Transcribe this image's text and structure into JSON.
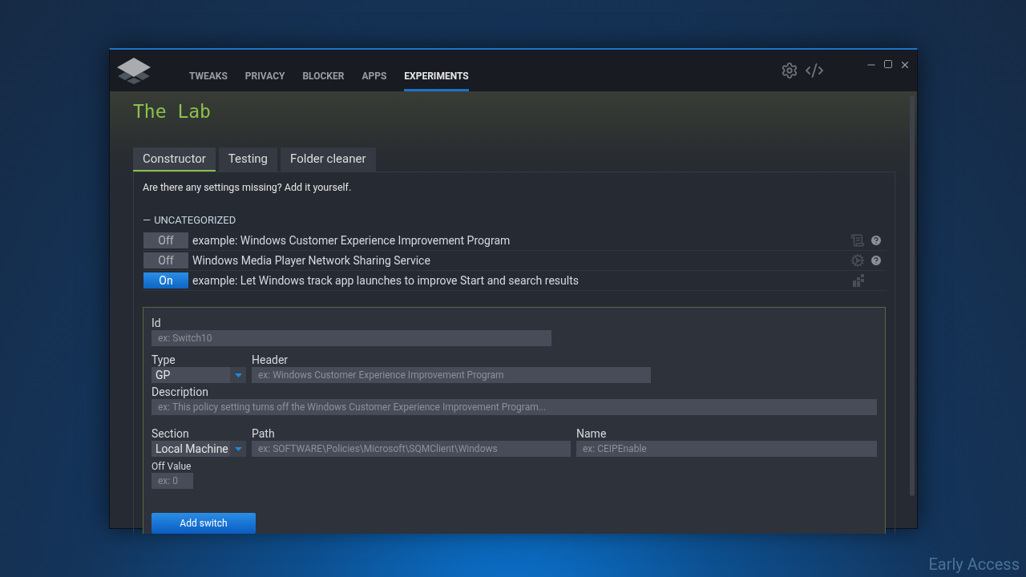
{
  "nav": [
    {
      "label": "TWEAKS",
      "selected": false
    },
    {
      "label": "PRIVACY",
      "selected": false
    },
    {
      "label": "BLOCKER",
      "selected": false
    },
    {
      "label": "APPS",
      "selected": false
    },
    {
      "label": "EXPERIMENTS",
      "selected": true
    }
  ],
  "page_title": "The Lab",
  "tabs": [
    {
      "label": "Constructor",
      "selected": true
    },
    {
      "label": "Testing",
      "selected": false
    },
    {
      "label": "Folder cleaner",
      "selected": false
    }
  ],
  "intro": "Are there any settings missing? Add it yourself.",
  "category": {
    "marker": "—",
    "label": "UNCATEGORIZED",
    "expanded": true
  },
  "switches": [
    {
      "state_label": "Off",
      "on": false,
      "label": "example: Windows Customer Experience Improvement Program",
      "help": true
    },
    {
      "state_label": "Off",
      "on": false,
      "label": "Windows Media Player Network Sharing Service",
      "help": true
    },
    {
      "state_label": "On",
      "on": true,
      "label": "example: Let Windows track app launches to improve Start and search results",
      "help": false
    }
  ],
  "form": {
    "id": {
      "label": "Id",
      "placeholder": "ex: Switch10"
    },
    "type": {
      "label": "Type",
      "value": "GP"
    },
    "header": {
      "label": "Header",
      "placeholder": "ex: Windows Customer Experience Improvement Program"
    },
    "description": {
      "label": "Description",
      "placeholder": "ex: This policy setting turns off the Windows Customer Experience Improvement Program..."
    },
    "section": {
      "label": "Section",
      "value": "Local Machine"
    },
    "path": {
      "label": "Path",
      "placeholder": "ex: SOFTWARE\\Policies\\Microsoft\\SQMClient\\Windows"
    },
    "name": {
      "label": "Name",
      "placeholder": "ex: CEIPEnable"
    },
    "off_value": {
      "label": "Off Value",
      "placeholder": "ex: 0"
    },
    "submit": "Add switch"
  },
  "desktop_label": "Early Access"
}
